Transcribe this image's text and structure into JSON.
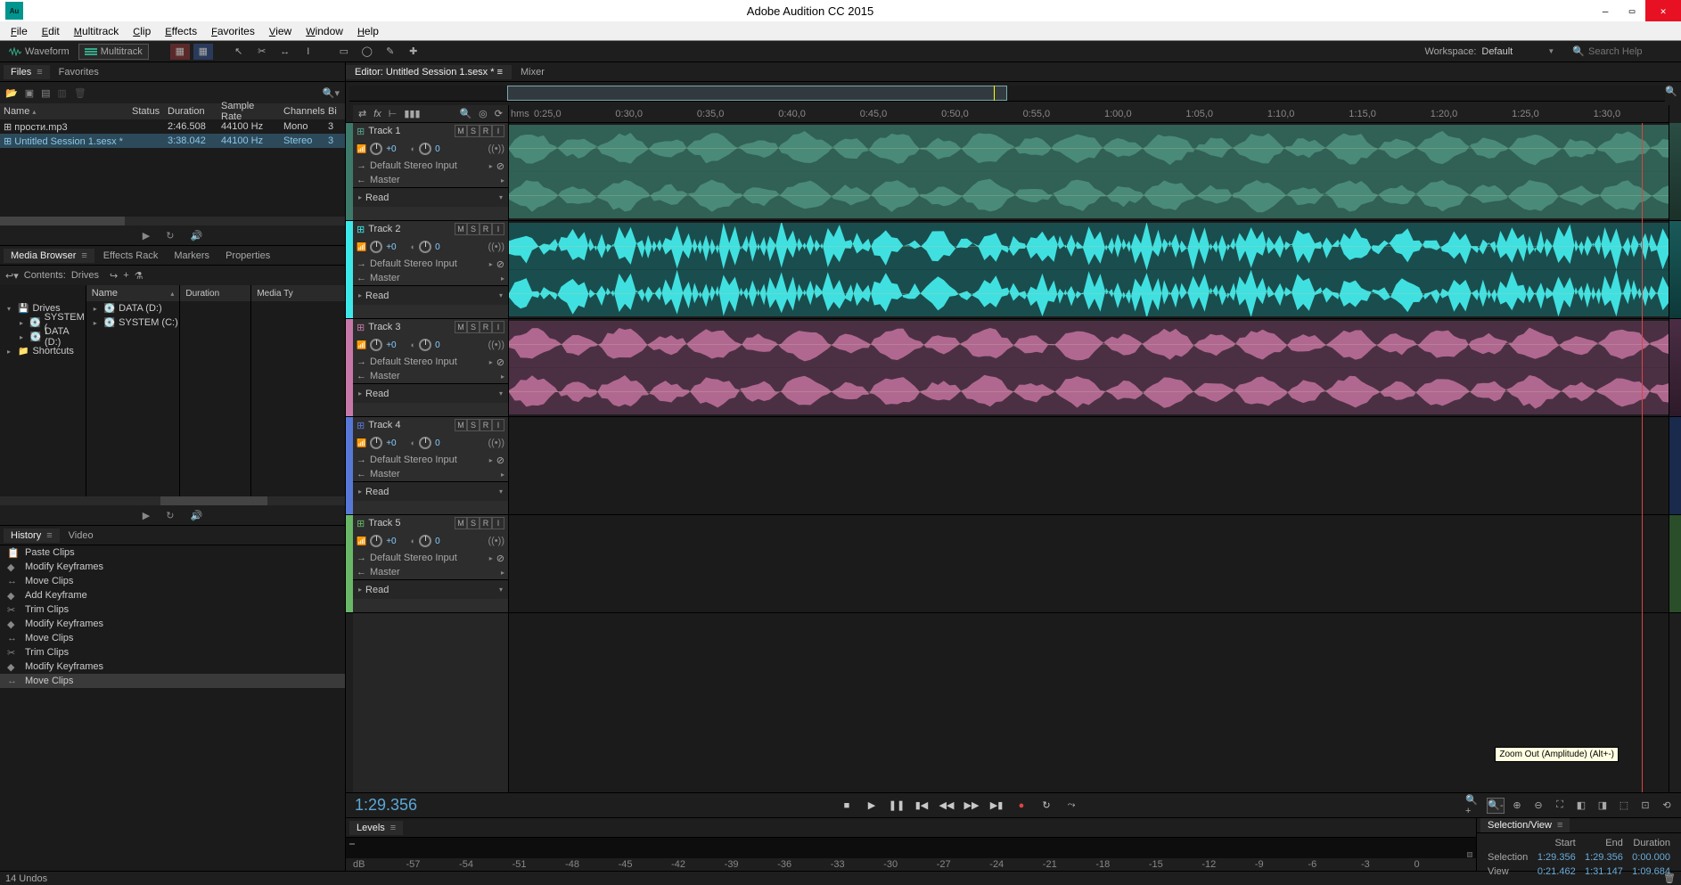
{
  "app": {
    "title": "Adobe Audition CC 2015",
    "logo": "Au"
  },
  "menu": {
    "items": [
      "File",
      "Edit",
      "Multitrack",
      "Clip",
      "Effects",
      "Favorites",
      "View",
      "Window",
      "Help"
    ]
  },
  "modes": {
    "waveform": "Waveform",
    "multitrack": "Multitrack"
  },
  "workspace": {
    "label": "Workspace:",
    "name": "Default"
  },
  "search_placeholder": "Search Help",
  "files_panel": {
    "tab": "Files",
    "tab2": "Favorites",
    "cols": {
      "name": "Name",
      "status": "Status",
      "dur": "Duration",
      "sr": "Sample Rate",
      "ch": "Channels",
      "bd": "Bi"
    },
    "rows": [
      {
        "name": "прости.mp3",
        "dur": "2:46.508",
        "sr": "44100 Hz",
        "ch": "Mono",
        "bd": "3",
        "sel": false
      },
      {
        "name": "Untitled Session 1.sesx *",
        "dur": "3:38.042",
        "sr": "44100 Hz",
        "ch": "Stereo",
        "bd": "3",
        "sel": true
      }
    ]
  },
  "media_browser": {
    "tabs": [
      "Media Browser",
      "Effects Rack",
      "Markers",
      "Properties"
    ],
    "contents_label": "Contents:",
    "contents_value": "Drives",
    "col_name": "Name",
    "col_dur": "Duration",
    "col_mt": "Media Ty",
    "left_tree": [
      {
        "label": "Drives",
        "children": [
          {
            "label": "SYSTEM ("
          },
          {
            "label": "DATA (D:)"
          }
        ]
      },
      {
        "label": "Shortcuts"
      }
    ],
    "right_tree": [
      {
        "label": "DATA (D:)"
      },
      {
        "label": "SYSTEM (C:)"
      }
    ]
  },
  "history": {
    "tabs": [
      "History",
      "Video"
    ],
    "items": [
      {
        "icon": "clipboard",
        "label": "Paste Clips"
      },
      {
        "icon": "diamond",
        "label": "Modify Keyframes"
      },
      {
        "icon": "move",
        "label": "Move Clips"
      },
      {
        "icon": "diamond",
        "label": "Add Keyframe"
      },
      {
        "icon": "trim",
        "label": "Trim Clips"
      },
      {
        "icon": "diamond",
        "label": "Modify Keyframes"
      },
      {
        "icon": "move",
        "label": "Move Clips"
      },
      {
        "icon": "trim",
        "label": "Trim Clips"
      },
      {
        "icon": "diamond",
        "label": "Modify Keyframes"
      },
      {
        "icon": "move",
        "label": "Move Clips",
        "sel": true
      }
    ],
    "undos": "14 Undos"
  },
  "editor": {
    "tab": "Editor: Untitled Session 1.sesx *",
    "mixer_tab": "Mixer",
    "ruler_unit": "hms",
    "ruler_ticks": [
      "0:25,0",
      "0:30,0",
      "0:35,0",
      "0:40,0",
      "0:45,0",
      "0:50,0",
      "0:55,0",
      "1:00,0",
      "1:05,0",
      "1:10,0",
      "1:15,0",
      "1:20,0",
      "1:25,0",
      "1:30,0"
    ],
    "tracks": [
      {
        "name": "Track 1",
        "color": "#5aa590",
        "wavecolor": "#4a8a78",
        "clipcolor": "#2d5a50",
        "input": "Default Stereo Input",
        "output": "Master",
        "auto": "Read",
        "vol": "+0",
        "pan": "0"
      },
      {
        "name": "Track 2",
        "color": "#3de8e8",
        "wavecolor": "#40e0e0",
        "clipcolor": "#143838",
        "input": "Default Stereo Input",
        "output": "Master",
        "auto": "Read",
        "vol": "+0",
        "pan": "0"
      },
      {
        "name": "Track 3",
        "color": "#c878a8",
        "wavecolor": "#b06890",
        "clipcolor": "#3d2838",
        "input": "Default Stereo Input",
        "output": "Master",
        "auto": "Read",
        "vol": "+0",
        "pan": "0"
      },
      {
        "name": "Track 4",
        "color": "#5878d8",
        "wavecolor": "#5878d8",
        "clipcolor": "#1e1e1e",
        "input": "Default Stereo Input",
        "output": "Master",
        "auto": "Read",
        "vol": "+0",
        "pan": "0",
        "empty": true
      },
      {
        "name": "Track 5",
        "color": "#68b868",
        "wavecolor": "#68b868",
        "clipcolor": "#1e1e1e",
        "input": "Default Stereo Input",
        "output": "Master",
        "auto": "Read",
        "vol": "+0",
        "pan": "0",
        "empty": true
      }
    ],
    "msr_labels": {
      "m": "M",
      "s": "S",
      "r": "R",
      "i": "I"
    }
  },
  "transport": {
    "time": "1:29.356",
    "tooltip": "Zoom Out (Amplitude) (Alt+-)"
  },
  "levels": {
    "tab": "Levels",
    "scale": [
      "dB",
      "-57",
      "-54",
      "-51",
      "-48",
      "-45",
      "-42",
      "-39",
      "-36",
      "-33",
      "-30",
      "-27",
      "-24",
      "-21",
      "-18",
      "-15",
      "-12",
      "-9",
      "-6",
      "-3",
      "0"
    ]
  },
  "selview": {
    "tab": "Selection/View",
    "head": {
      "start": "Start",
      "end": "End",
      "dur": "Duration"
    },
    "selection": {
      "label": "Selection",
      "start": "1:29.356",
      "end": "1:29.356",
      "dur": "0:00.000"
    },
    "view": {
      "label": "View",
      "start": "0:21.462",
      "end": "1:31.147",
      "dur": "1:09.684"
    }
  }
}
